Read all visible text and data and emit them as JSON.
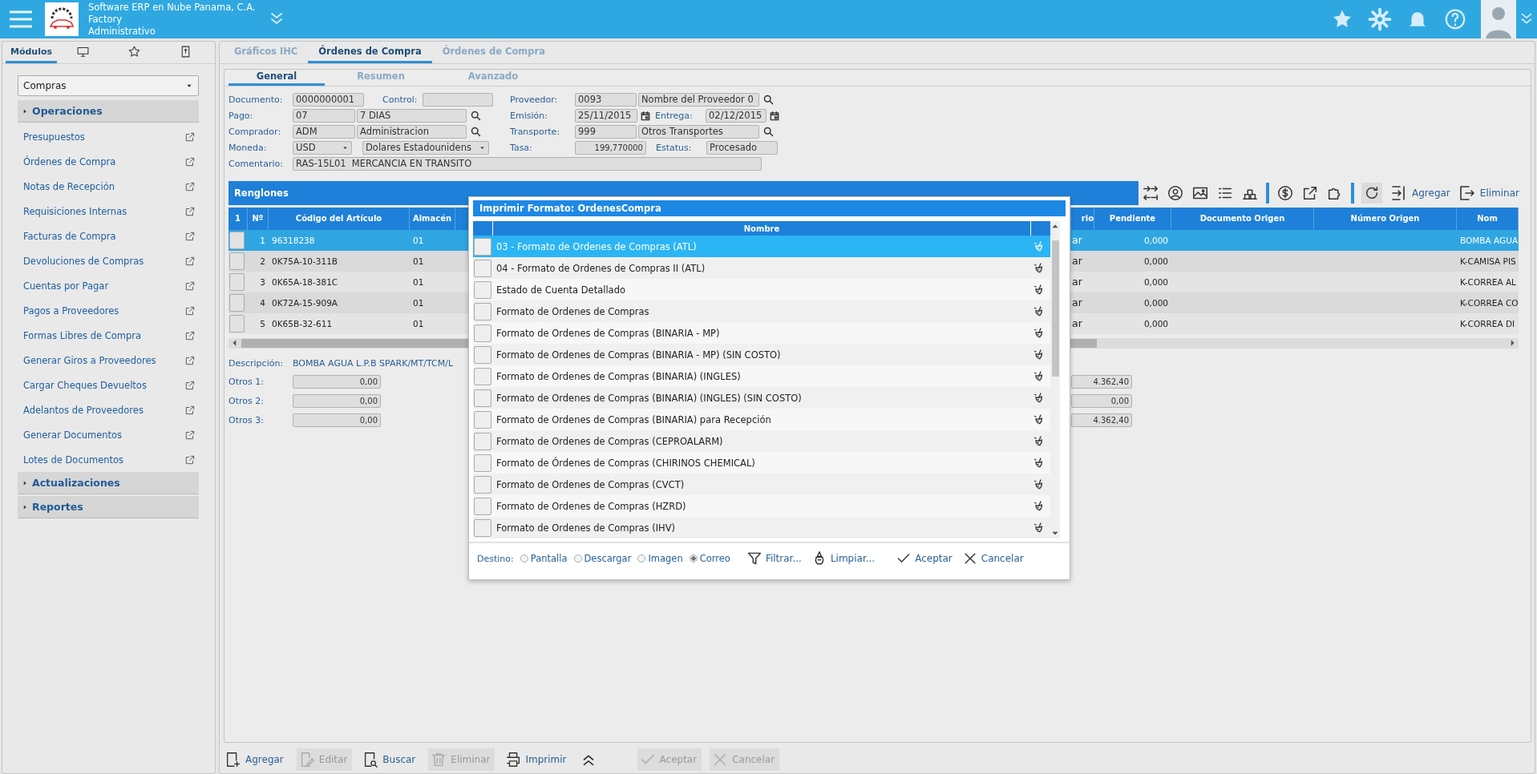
{
  "header": {
    "company": "Software ERP en Nube Panama, C.A.",
    "subtitle": "Factory",
    "role": "Administrativo"
  },
  "sidebar": {
    "tabs": [
      {
        "kind": "text",
        "label": "Módulos",
        "selected": true
      },
      {
        "kind": "monitor",
        "selected": false
      },
      {
        "kind": "star",
        "selected": false
      },
      {
        "kind": "document",
        "selected": false
      }
    ],
    "module_select": "Compras",
    "sections": [
      {
        "title": "Operaciones",
        "items": [
          "Presupuestos",
          "Órdenes de Compra",
          "Notas de Recepción",
          "Requisiciones Internas",
          "Facturas de Compra",
          "Devoluciones de Compras",
          "Cuentas por Pagar",
          "Pagos a Proveedores",
          "Formas Libres de Compra",
          "Generar Giros a Proveedores",
          "Cargar Cheques Devueltos",
          "Adelantos de Proveedores",
          "Generar Documentos",
          "Lotes de Documentos"
        ]
      },
      {
        "title": "Actualizaciones"
      },
      {
        "title": "Reportes"
      }
    ]
  },
  "main_tabs": [
    {
      "label": "Gráficos IHC",
      "selected": false
    },
    {
      "label": "Órdenes de Compra",
      "selected": true
    },
    {
      "label": "Órdenes de Compra",
      "selected": false
    }
  ],
  "sub_tabs": [
    {
      "label": "General",
      "selected": true
    },
    {
      "label": "Resumen",
      "selected": false
    },
    {
      "label": "Avanzado",
      "selected": false
    }
  ],
  "form": {
    "documento": {
      "label": "Documento:",
      "value": "0000000001"
    },
    "control": {
      "label": "Control:"
    },
    "pago": {
      "label": "Pago:",
      "code": "07",
      "name": "7 DIAS"
    },
    "comprador": {
      "label": "Comprador:",
      "code": "ADM",
      "name": "Administracion"
    },
    "moneda": {
      "label": "Moneda:",
      "code": "USD",
      "name": "Dolares Estadounidens"
    },
    "comentario": {
      "label": "Comentario:",
      "value": "RAS-15L01  MERCANCIA EN TRANSITO"
    },
    "proveedor": {
      "label": "Proveedor:",
      "code": "0093",
      "name": "Nombre del Proveedor 0"
    },
    "emision": {
      "label": "Emisión:",
      "value": "25/11/2015"
    },
    "entrega": {
      "label": "Entrega:",
      "value": "02/12/2015"
    },
    "transporte": {
      "label": "Transporte:",
      "code": "999",
      "name": "Otros Transportes"
    },
    "tasa": {
      "label": "Tasa:",
      "value": "199,770000"
    },
    "estatus": {
      "label": "Estatus:",
      "value": "Procesado"
    }
  },
  "lines": {
    "title": "Renglones",
    "add": "Agregar",
    "remove": "Eliminar",
    "columns": {
      "check": "1",
      "number": "Nº",
      "code": "Código del Artículo",
      "warehouse": "Almacén",
      "column_6": "rio",
      "pending": "Pendiente",
      "origin_document": "Documento Origen",
      "origin_number": "Número Origen",
      "column_10": "Nom"
    },
    "rows": [
      {
        "selected": true,
        "number": "1",
        "code": "96318238",
        "warehouse": "01",
        "column_6": "ar",
        "pending": "0,000",
        "column_10": "BOMBA AGUA"
      },
      {
        "selected": false,
        "number": "2",
        "code": "0K75A-10-311B",
        "warehouse": "01",
        "column_6": "ar",
        "pending": "0,000",
        "column_10": "K-CAMISA PIS"
      },
      {
        "selected": false,
        "number": "3",
        "code": "0K65A-18-381C",
        "warehouse": "01",
        "column_6": "ar",
        "pending": "0,000",
        "column_10": "K-CORREA AL"
      },
      {
        "selected": false,
        "number": "4",
        "code": "0K72A-15-909A",
        "warehouse": "01",
        "column_6": "ar",
        "pending": "0,000",
        "column_10": "K-CORREA CO"
      },
      {
        "selected": false,
        "number": "5",
        "code": "0K65B-32-611",
        "warehouse": "01",
        "column_6": "ar",
        "pending": "0,000",
        "column_10": "K-CORREA DI"
      }
    ]
  },
  "description": {
    "label": "Descripción:",
    "value": "BOMBA AGUA L.P.B SPARK/MT/TCM/L"
  },
  "others": [
    {
      "label": "Otros 1:",
      "value": "0,00",
      "right_value": "4.362,40"
    },
    {
      "label": "Otros 2:",
      "value": "0,00",
      "right_value": "0,00"
    },
    {
      "label": "Otros 3:",
      "value": "0,00",
      "right_value": "4.362,40"
    }
  ],
  "actions": [
    {
      "kind": "add",
      "label": "Agregar",
      "disabled": false
    },
    {
      "kind": "edit",
      "label": "Editar",
      "disabled": true
    },
    {
      "kind": "search",
      "label": "Buscar",
      "disabled": false
    },
    {
      "kind": "delete",
      "label": "Eliminar",
      "disabled": true
    },
    {
      "kind": "print",
      "label": "Imprimir",
      "disabled": false
    },
    {
      "kind": "accept",
      "label": "Aceptar",
      "disabled": true
    },
    {
      "kind": "cancel",
      "label": "Cancelar",
      "disabled": true
    }
  ],
  "print_dialog": {
    "title": "Imprimir Formato: OrdenesCompra",
    "column": "Nombre",
    "formats": [
      {
        "name": "03 - Formato de Ordenes de Compras (ATL)",
        "selected": true
      },
      {
        "name": "04 - Formato de Ordenes de Compras II (ATL)",
        "selected": false
      },
      {
        "name": "Estado de Cuenta Detallado",
        "selected": false
      },
      {
        "name": "Formato de Ordenes de Compras",
        "selected": false
      },
      {
        "name": "Formato de Ordenes de Compras (BINARIA - MP)",
        "selected": false
      },
      {
        "name": "Formato de Ordenes de Compras (BINARIA - MP) (SIN COSTO)",
        "selected": false
      },
      {
        "name": "Formato de Ordenes de Compras (BINARIA) (INGLES)",
        "selected": false
      },
      {
        "name": "Formato de Ordenes de Compras (BINARIA) (INGLES) (SIN COSTO)",
        "selected": false
      },
      {
        "name": "Formato de Ordenes de Compras (BINARIA) para Recepción",
        "selected": false
      },
      {
        "name": "Formato de Ordenes de Compras (CEPROALARM)",
        "selected": false
      },
      {
        "name": "Formato de Órdenes de Compras (CHIRINOS CHEMICAL)",
        "selected": false
      },
      {
        "name": "Formato de Ordenes de Compras (CVCT)",
        "selected": false
      },
      {
        "name": "Formato de Ordenes de Compras (HZRD)",
        "selected": false
      },
      {
        "name": "Formato de Ordenes de Compras (IHV)",
        "selected": false
      }
    ],
    "destination_label": "Destino:",
    "destinations": [
      {
        "label": "Pantalla",
        "selected": false
      },
      {
        "label": "Descargar",
        "selected": false
      },
      {
        "label": "Imagen",
        "selected": false
      },
      {
        "label": "Correo",
        "selected": true
      }
    ],
    "buttons": [
      {
        "kind": "filter",
        "label": "Filtrar..."
      },
      {
        "kind": "clear",
        "label": "Limpiar..."
      },
      {
        "kind": "accept",
        "label": "Aceptar"
      },
      {
        "kind": "cancel",
        "label": "Cancelar"
      }
    ]
  }
}
